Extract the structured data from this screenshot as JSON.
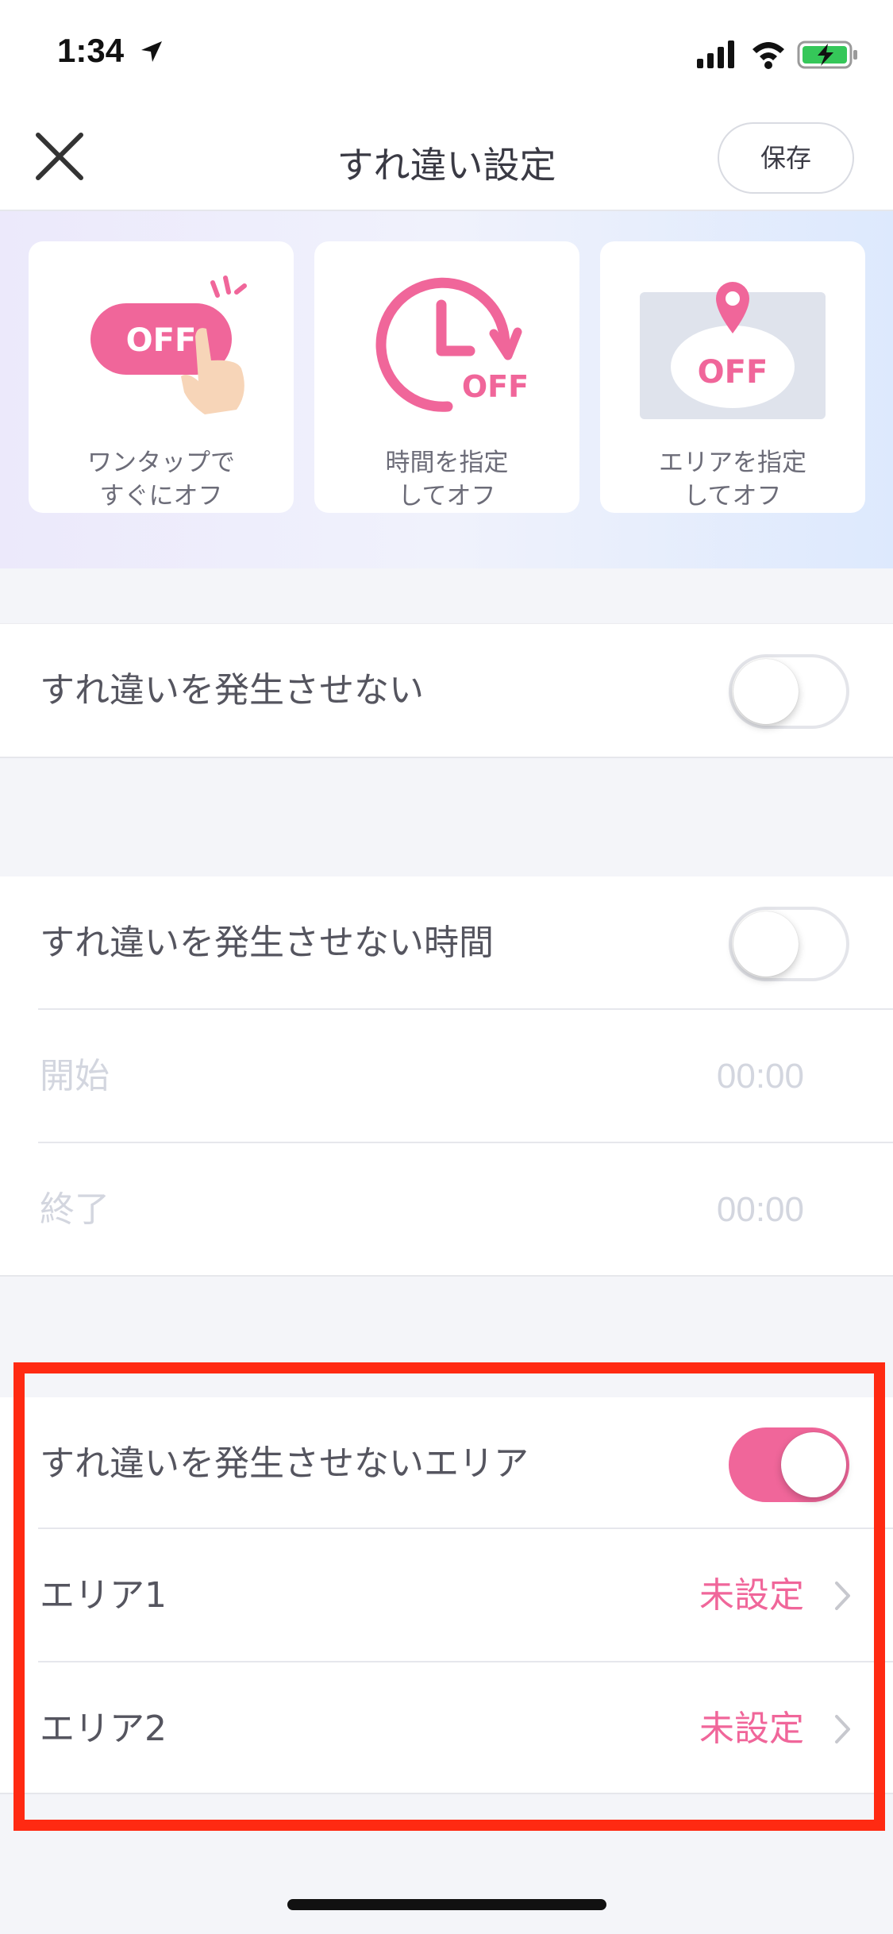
{
  "status_bar": {
    "time": "1:34"
  },
  "header": {
    "title": "すれ違い設定",
    "save_label": "保存"
  },
  "feature_cards": [
    {
      "badge": "OFF",
      "label_line1": "ワンタップで",
      "label_line2": "すぐにオフ"
    },
    {
      "badge": "OFF",
      "label_line1": "時間を指定",
      "label_line2": "してオフ"
    },
    {
      "badge": "OFF",
      "label_line1": "エリアを指定",
      "label_line2": "してオフ"
    }
  ],
  "settings": {
    "no_encounter": {
      "label": "すれ違いを発生させない",
      "enabled": false
    },
    "no_encounter_time": {
      "label": "すれ違いを発生させない時間",
      "enabled": false,
      "start_label": "開始",
      "start_value": "00:00",
      "end_label": "終了",
      "end_value": "00:00"
    },
    "no_encounter_area": {
      "label": "すれ違いを発生させないエリア",
      "enabled": true,
      "areas": [
        {
          "label": "エリア1",
          "value": "未設定"
        },
        {
          "label": "エリア2",
          "value": "未設定"
        }
      ]
    }
  },
  "colors": {
    "accent": "#f0669a",
    "highlight_border": "#ff2a12",
    "disabled_text": "#d3d6df",
    "background": "#f4f5f9"
  }
}
